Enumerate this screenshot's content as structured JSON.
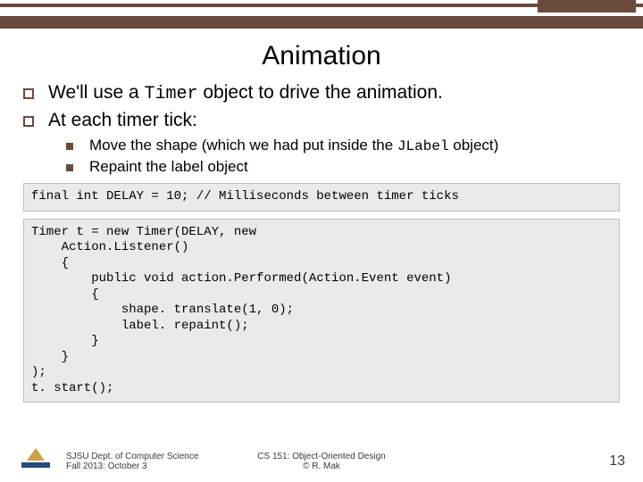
{
  "title": "Animation",
  "bullets": [
    {
      "level": 1,
      "prefix": "We'll use a ",
      "code": "Timer",
      "suffix": " object to drive the animation."
    },
    {
      "level": 1,
      "prefix": "At each timer tick:",
      "code": "",
      "suffix": ""
    },
    {
      "level": 2,
      "prefix": "Move the shape (which we had put inside the ",
      "code": "JLabel",
      "suffix": " object)"
    },
    {
      "level": 2,
      "prefix": "Repaint the label object",
      "code": "",
      "suffix": ""
    }
  ],
  "code1": "final int DELAY = 10; // Milliseconds between timer ticks",
  "code2": "Timer t = new Timer(DELAY, new\n    Action.Listener()\n    {\n        public void action.Performed(Action.Event event)\n        {\n            shape. translate(1, 0);\n            label. repaint();\n        }\n    }\n);\nt. start();",
  "footer": {
    "left": "SJSU Dept. of Computer Science\nFall 2013: October 3",
    "center": "CS 151: Object-Oriented Design\n© R. Mak",
    "page": "13"
  }
}
